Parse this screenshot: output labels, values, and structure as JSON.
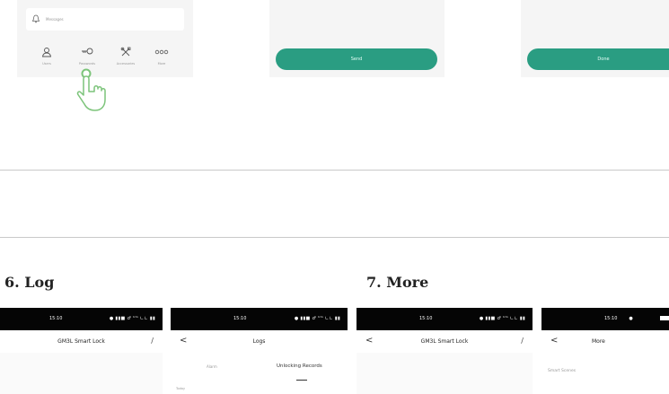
{
  "top_panel": {
    "notification_label": "Messages",
    "nav_items": [
      {
        "label": "Users",
        "icon": "user-icon"
      },
      {
        "label": "Passwords",
        "icon": "key-icon"
      },
      {
        "label": "Accessories",
        "icon": "tools-icon"
      },
      {
        "label": "More",
        "icon": "more-icon"
      }
    ],
    "send_button_1": "Send",
    "send_button_2": "Done"
  },
  "sections": [
    {
      "heading": "6. Log"
    },
    {
      "heading": "7. More"
    }
  ],
  "phones": [
    {
      "time": "15:10",
      "status": "● ▮▮■ ♂ ᵁᵐ ∟∟ ▮▮",
      "title": "GM3L Smart Lock",
      "left_icon": "<",
      "right_icon": "∕"
    },
    {
      "time": "15:10",
      "status": "● ▮▮■ ♂ ᵁᵐ ∟∟ ▮▮",
      "title": "Logs",
      "left_icon": "<",
      "tabs": [
        "Alarm",
        "Unlocking Records"
      ],
      "sub": "Today"
    },
    {
      "time": "15:10",
      "status": "● ▮▮■ ♂ ᵁᵐ ∟∟ ▮▮",
      "title": "GM3L Smart Lock",
      "left_icon": "<",
      "right_icon": "∕"
    },
    {
      "time": "15:10",
      "status": "●",
      "title": "More",
      "left_icon": "<",
      "item": "Smart Scenes"
    }
  ],
  "colors": {
    "accent": "#2a9d82",
    "hand": "#7cc47a"
  }
}
